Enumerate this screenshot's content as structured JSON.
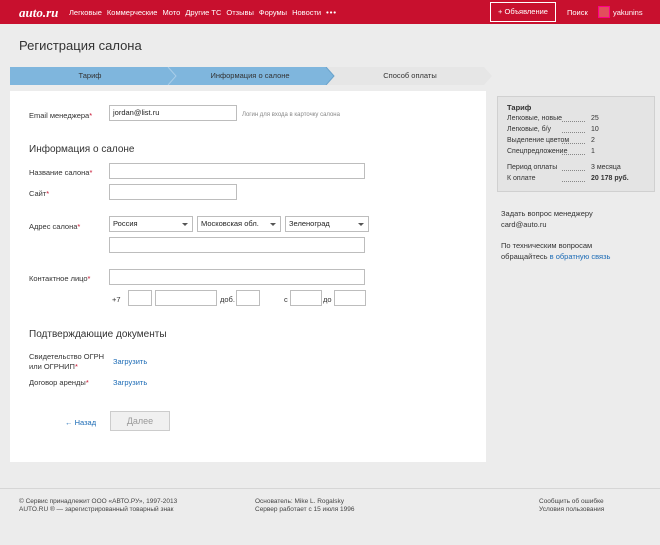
{
  "header": {
    "logo": "auto.ru",
    "nav": [
      "Легковые",
      "Коммерческие",
      "Мото",
      "Другие ТС",
      "Отзывы",
      "Форумы",
      "Новости"
    ],
    "more": "•••",
    "post_ad": "+ Объявление",
    "search": "Поиск",
    "username": "yakunins"
  },
  "page": {
    "title": "Регистрация салона"
  },
  "steps": [
    "Тариф",
    "Информация о салоне",
    "Способ оплаты"
  ],
  "form": {
    "email_label": "Email менеджера",
    "email_value": "jordan@list.ru",
    "email_hint": "Логин для входа в карточку салона",
    "info_heading": "Информация о салоне",
    "name_label": "Название салона",
    "site_label": "Сайт",
    "address_label": "Адрес салона",
    "country": "Россия",
    "region": "Московская обл.",
    "city": "Зеленоград",
    "contact_label": "Контактное лицо",
    "phone_prefix": "+7",
    "ext_label": "доб.",
    "from_label": "с",
    "to_label": "до",
    "req_mark": "*",
    "docs_heading": "Подтверждающие документы",
    "ogrn_label_1": "Свидетельство ОГРН",
    "ogrn_label_2": "или ОГРНИП",
    "upload": "Загрузить",
    "lease_label": "Договор аренды",
    "back": "← Назад",
    "next": "Далее"
  },
  "sidebar": {
    "tariff_title": "Тариф",
    "rows": [
      {
        "k": "Легковые, новые",
        "v": "25"
      },
      {
        "k": "Легковые, б/у",
        "v": "10"
      },
      {
        "k": "Выделение цветом",
        "v": "2"
      },
      {
        "k": "Спецпредложение",
        "v": "1"
      }
    ],
    "period_label": "Период оплаты",
    "period_value": "3 месяца",
    "pay_label": "К оплате",
    "pay_value": "20 178 руб.",
    "ask_manager": "Задать вопрос менеджеру",
    "manager_email": "card@auto.ru",
    "tech_1": "По техническим вопросам",
    "tech_2": "обращайтесь",
    "tech_link": "в обратную связь"
  },
  "footer": {
    "copyright": "© Сервис принадлежит ООО «АВТО.РУ», 1997-2013",
    "trademark": "AUTO.RU ® — зарегистрированный товарный знак",
    "founder": "Основатель: Mike L. Rogalsky",
    "uptime": "Сервер работает с 15 июля 1996",
    "report_error": "Сообщить об ошибке",
    "terms": "Условия пользования"
  },
  "colors": {
    "brand": "#c8102e",
    "link": "#1a6ab5",
    "active_step": "#7fb6dd"
  }
}
